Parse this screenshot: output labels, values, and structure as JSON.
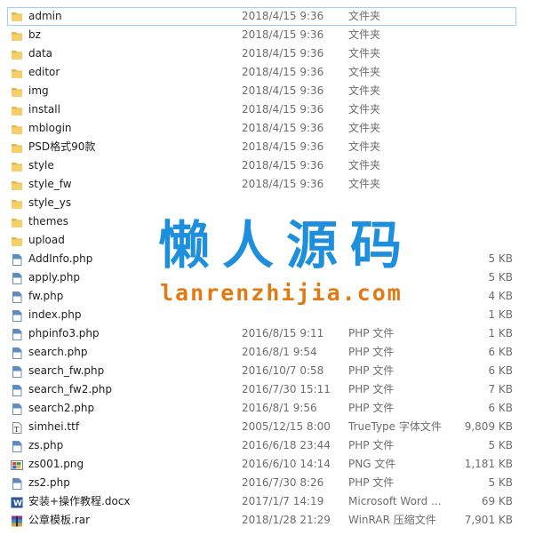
{
  "files": [
    {
      "name": "admin",
      "date": "2018/4/15 9:36",
      "type": "文件夹",
      "size": "",
      "icon": "folder-icon",
      "selected": true
    },
    {
      "name": "bz",
      "date": "2018/4/15 9:36",
      "type": "文件夹",
      "size": "",
      "icon": "folder-icon"
    },
    {
      "name": "data",
      "date": "2018/4/15 9:36",
      "type": "文件夹",
      "size": "",
      "icon": "folder-icon"
    },
    {
      "name": "editor",
      "date": "2018/4/15 9:36",
      "type": "文件夹",
      "size": "",
      "icon": "folder-icon"
    },
    {
      "name": "img",
      "date": "2018/4/15 9:36",
      "type": "文件夹",
      "size": "",
      "icon": "folder-icon"
    },
    {
      "name": "install",
      "date": "2018/4/15 9:36",
      "type": "文件夹",
      "size": "",
      "icon": "folder-icon"
    },
    {
      "name": "mblogin",
      "date": "2018/4/15 9:36",
      "type": "文件夹",
      "size": "",
      "icon": "folder-icon"
    },
    {
      "name": "PSD格式90款",
      "date": "2018/4/15 9:36",
      "type": "文件夹",
      "size": "",
      "icon": "folder-icon"
    },
    {
      "name": "style",
      "date": "2018/4/15 9:36",
      "type": "文件夹",
      "size": "",
      "icon": "folder-icon"
    },
    {
      "name": "style_fw",
      "date": "2018/4/15 9:36",
      "type": "文件夹",
      "size": "",
      "icon": "folder-icon"
    },
    {
      "name": "style_ys",
      "date": "",
      "type": "",
      "size": "",
      "icon": "folder-icon"
    },
    {
      "name": "themes",
      "date": "",
      "type": "",
      "size": "",
      "icon": "folder-icon"
    },
    {
      "name": "upload",
      "date": "",
      "type": "",
      "size": "",
      "icon": "folder-icon"
    },
    {
      "name": "AddInfo.php",
      "date": "",
      "type": "",
      "size": "5 KB",
      "icon": "php-file-icon"
    },
    {
      "name": "apply.php",
      "date": "",
      "type": "",
      "size": "5 KB",
      "icon": "php-file-icon"
    },
    {
      "name": "fw.php",
      "date": "",
      "type": "",
      "size": "4 KB",
      "icon": "php-file-icon"
    },
    {
      "name": "index.php",
      "date": "",
      "type": "",
      "size": "1 KB",
      "icon": "php-file-icon"
    },
    {
      "name": "phpinfo3.php",
      "date": "2016/8/15 9:11",
      "type": "PHP 文件",
      "size": "1 KB",
      "icon": "php-file-icon"
    },
    {
      "name": "search.php",
      "date": "2016/8/1 9:54",
      "type": "PHP 文件",
      "size": "6 KB",
      "icon": "php-file-icon"
    },
    {
      "name": "search_fw.php",
      "date": "2016/10/7 0:58",
      "type": "PHP 文件",
      "size": "6 KB",
      "icon": "php-file-icon"
    },
    {
      "name": "search_fw2.php",
      "date": "2016/7/30 15:11",
      "type": "PHP 文件",
      "size": "7 KB",
      "icon": "php-file-icon"
    },
    {
      "name": "search2.php",
      "date": "2016/8/1 9:56",
      "type": "PHP 文件",
      "size": "6 KB",
      "icon": "php-file-icon"
    },
    {
      "name": "simhei.ttf",
      "date": "2005/12/15 8:00",
      "type": "TrueType 字体文件",
      "size": "9,809 KB",
      "icon": "font-file-icon"
    },
    {
      "name": "zs.php",
      "date": "2016/6/18 23:44",
      "type": "PHP 文件",
      "size": "5 KB",
      "icon": "php-file-icon"
    },
    {
      "name": "zs001.png",
      "date": "2016/6/10 14:14",
      "type": "PNG 文件",
      "size": "1,181 KB",
      "icon": "image-file-icon"
    },
    {
      "name": "zs2.php",
      "date": "2016/7/30 8:26",
      "type": "PHP 文件",
      "size": "5 KB",
      "icon": "php-file-icon"
    },
    {
      "name": "安装+操作教程.docx",
      "date": "2017/1/7 14:19",
      "type": "Microsoft Word ...",
      "size": "69 KB",
      "icon": "word-file-icon"
    },
    {
      "name": "公章模板.rar",
      "date": "2018/1/28 21:29",
      "type": "WinRAR 压缩文件",
      "size": "7,901 KB",
      "icon": "rar-file-icon"
    }
  ],
  "watermark": {
    "title": "懒人源码",
    "url": "lanrenzhijia.com",
    "color": "#1e8fdc"
  },
  "colors": {
    "folder": "#e8b84a",
    "selection_border": "#99d1ff"
  }
}
